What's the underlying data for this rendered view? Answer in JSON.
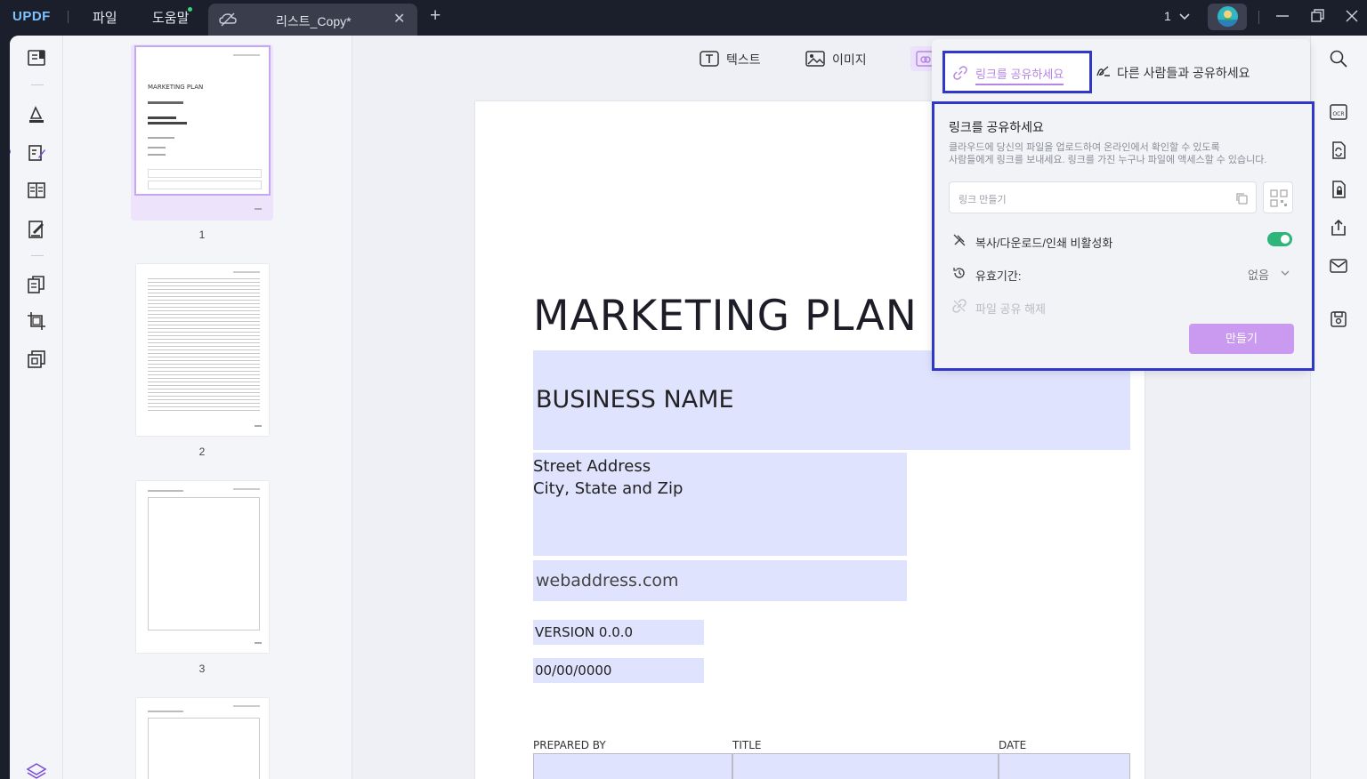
{
  "titlebar": {
    "logo": "UPDF",
    "menu": [
      "파일",
      "도움말"
    ],
    "tab_title": "리스트_Copy*",
    "page_indicator": "1"
  },
  "toolbar": {
    "text_label": "텍스트",
    "image_label": "이미지"
  },
  "thumbnails": [
    {
      "number": "1",
      "title": "MARKETING PLAN",
      "selected": true
    },
    {
      "number": "2",
      "selected": false
    },
    {
      "number": "3",
      "selected": false
    }
  ],
  "document": {
    "title": "MARKETING PLAN",
    "business_name": "BUSINESS NAME",
    "street": "Street Address",
    "city": "City, State and Zip",
    "web": "webaddress.com",
    "version": "VERSION 0.0.0",
    "date": "00/00/0000",
    "table_headers": [
      "PREPARED BY",
      "TITLE",
      "DATE"
    ]
  },
  "share": {
    "tab_link": "링크를 공유하세요",
    "tab_people": "다른 사람들과 공유하세요",
    "title": "링크를 공유하세요",
    "desc_line1": "클라우드에 당신의 파일을 업로드하여 온라인에서 확인할 수 있도록",
    "desc_line2": "사람들에게 링크를 보내세요. 링크를 가진 누구나 파일에 액세스할 수 있습니다.",
    "link_placeholder": "링크 만들기",
    "disable_copy_label": "복사/다운로드/인쇄 비활성화",
    "disable_copy_on": true,
    "expiry_label": "유효기간:",
    "expiry_value": "없음",
    "unshare_label": "파일 공유 해제",
    "create_button": "만들기"
  },
  "colors": {
    "accent": "#b685e6",
    "highlight_box": "#2f38c9",
    "field_fill": "#dfe3fd",
    "toggle_on": "#2db57a"
  }
}
